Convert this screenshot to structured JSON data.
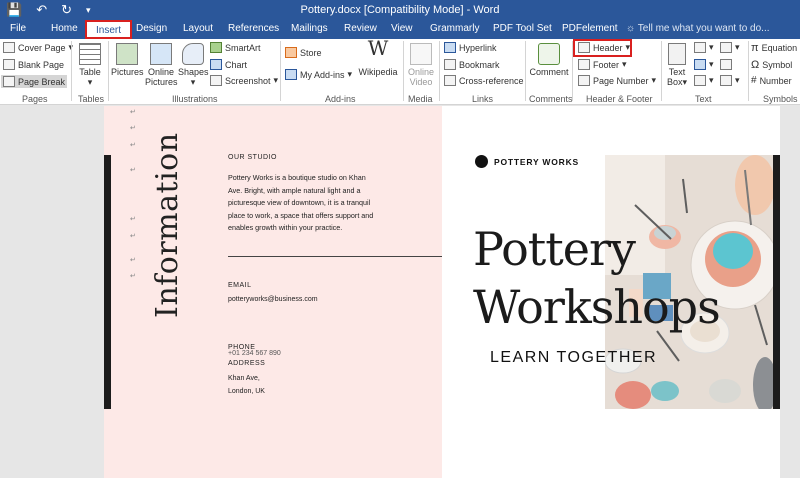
{
  "window": {
    "title": "Pottery.docx [Compatibility Mode] - Word"
  },
  "tabs": [
    {
      "label": "File",
      "active": false
    },
    {
      "label": "Home",
      "active": false
    },
    {
      "label": "Insert",
      "active": true
    },
    {
      "label": "Design",
      "active": false
    },
    {
      "label": "Layout",
      "active": false
    },
    {
      "label": "References",
      "active": false
    },
    {
      "label": "Mailings",
      "active": false
    },
    {
      "label": "Review",
      "active": false
    },
    {
      "label": "View",
      "active": false
    },
    {
      "label": "Grammarly",
      "active": false
    },
    {
      "label": "PDF Tool Set",
      "active": false
    },
    {
      "label": "PDFelement",
      "active": false
    }
  ],
  "tellme": "Tell me what you want to do...",
  "ribbon": {
    "pages": {
      "label": "Pages",
      "cover_page": "Cover Page",
      "blank_page": "Blank Page",
      "page_break": "Page Break"
    },
    "tables": {
      "label": "Tables",
      "table": "Table"
    },
    "illustrations": {
      "label": "Illustrations",
      "pictures": "Pictures",
      "online_pictures_1": "Online",
      "online_pictures_2": "Pictures",
      "shapes": "Shapes",
      "smartart": "SmartArt",
      "chart": "Chart",
      "screenshot": "Screenshot"
    },
    "addins": {
      "label": "Add-ins",
      "store": "Store",
      "my_addins": "My Add-ins",
      "wikipedia": "Wikipedia"
    },
    "media": {
      "label": "Media",
      "online_video_1": "Online",
      "online_video_2": "Video"
    },
    "links": {
      "label": "Links",
      "hyperlink": "Hyperlink",
      "bookmark": "Bookmark",
      "cross_reference": "Cross-reference"
    },
    "comments": {
      "label": "Comments",
      "comment": "Comment"
    },
    "header_footer": {
      "label": "Header & Footer",
      "header": "Header",
      "footer": "Footer",
      "page_number": "Page Number"
    },
    "text": {
      "label": "Text",
      "text_box_1": "Text",
      "text_box_2": "Box"
    },
    "symbols": {
      "label": "Symbols",
      "equation": "Equation",
      "symbol": "Symbol",
      "number": "Number"
    }
  },
  "document": {
    "vertical_title": "Information",
    "studio_heading": "OUR STUDIO",
    "studio_lines": [
      "Pottery Works is a boutique studio on Khan",
      "Ave. Bright, with ample natural light and a",
      "picturesque view of downtown, it is a tranquil",
      "place to work, a space that offers support and",
      "enables growth within your practice."
    ],
    "email_heading": "EMAIL",
    "email_value": "potteryworks@business.com",
    "phone_heading": "PHONE",
    "phone_value": "+01 234 567 890",
    "address_heading": "ADDRESS",
    "address_line1": "Khan Ave,",
    "address_line2": "London, UK",
    "brand": "POTTERY WORKS",
    "headline_line1": "Pottery",
    "headline_line2": "Workshops",
    "tagline": "LEARN TOGETHER"
  },
  "colors": {
    "accent_blue": "#2b579a",
    "highlight_red": "#d9201f",
    "left_page_pink": "#fde9e7"
  }
}
